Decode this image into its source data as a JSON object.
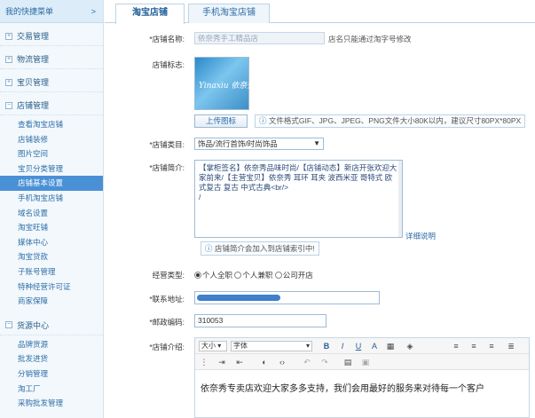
{
  "sidebar": {
    "shortcut_label": "我的快捷菜单",
    "shortcut_arrow": ">",
    "sections": {
      "s1": "交易管理",
      "s2": "物流管理",
      "s3": "宝贝管理",
      "s4": "店铺管理",
      "s5": "货源中心"
    },
    "store_items": [
      "查看淘宝店铺",
      "店铺装修",
      "图片空间",
      "宝贝分类管理",
      "店铺基本设置",
      "手机淘宝店铺",
      "域名设置",
      "淘宝旺铺",
      "媒体中心",
      "淘宝贷款",
      "子账号管理",
      "特种经营许可证",
      "商家保障"
    ],
    "source_items": [
      "品牌货源",
      "批发进货",
      "分销管理",
      "淘工厂",
      "采购批发管理"
    ],
    "active_item": "店铺基本设置"
  },
  "tabs": [
    "淘宝店铺",
    "手机淘宝店铺"
  ],
  "form": {
    "shop_name_label": "*店铺名称:",
    "shop_name_value": "依奈秀手工精品店",
    "shop_name_hint": "店名只能通过淘字号修改",
    "logo_label": "店铺标志:",
    "logo_text": "Yinaxiu 依奈秀",
    "upload_button": "上传图标",
    "upload_hint": "文件格式GIF、JPG、JPEG、PNG文件大小80K以内，建议尺寸80PX*80PX",
    "category_label": "*店铺类目:",
    "category_value": "饰品/流行首饰/时尚饰品",
    "intro_label": "*店铺简介:",
    "intro_text": "【掌柜签名】依奈秀品味时尚/【店铺动态】新店开张欢迎大家前来/【主营宝贝】依奈秀 耳环 耳夹 波西米亚 哥特式 欧式复古 复古 中式古典<br/>",
    "intro_cursor": "/",
    "intro_help": "详细说明",
    "intro_search_hint": "店铺简介会加入到店铺索引中!",
    "biz_type_label": "经营类型:",
    "biz_options": [
      "个人全职",
      "个人兼职",
      "公司开店"
    ],
    "address_label": "*联系地址:",
    "zip_label": "*邮政编码:",
    "zip_value": "310053",
    "desc_label": "*店铺介绍:",
    "editor": {
      "font_size": "大小",
      "font_family": "字体",
      "content": "依奈秀专卖店欢迎大家多多支持，我们会用最好的服务来对待每一个客户"
    }
  },
  "colors": {
    "accent": "#2b6aa5",
    "active_bg": "#4a90d6",
    "address_bar": "#3f7fcb"
  }
}
